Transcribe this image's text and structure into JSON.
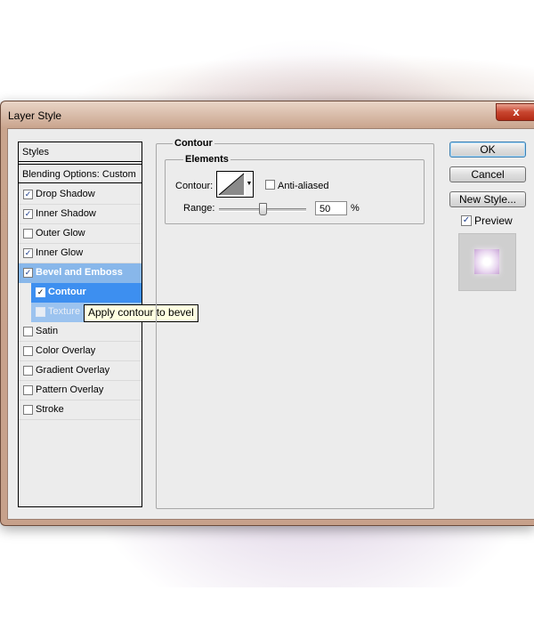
{
  "window": {
    "title": "Layer Style",
    "close_glyph": "x"
  },
  "styles": {
    "header": "Styles",
    "blending": "Blending Options: Custom",
    "items": [
      {
        "label": "Drop Shadow",
        "checked": true
      },
      {
        "label": "Inner Shadow",
        "checked": true
      },
      {
        "label": "Outer Glow",
        "checked": false
      },
      {
        "label": "Inner Glow",
        "checked": true
      },
      {
        "label": "Bevel and Emboss",
        "checked": true
      },
      {
        "label": "Contour",
        "checked": true
      },
      {
        "label": "Texture",
        "checked": false
      },
      {
        "label": "Satin",
        "checked": false
      },
      {
        "label": "Color Overlay",
        "checked": false
      },
      {
        "label": "Gradient Overlay",
        "checked": false
      },
      {
        "label": "Pattern Overlay",
        "checked": false
      },
      {
        "label": "Stroke",
        "checked": false
      }
    ]
  },
  "tooltip": "Apply contour to bevel",
  "contour": {
    "group_title": "Contour",
    "elements_title": "Elements",
    "contour_label": "Contour:",
    "anti_aliased_label": "Anti-aliased",
    "anti_aliased": false,
    "range_label": "Range:",
    "range_value": "50",
    "range_unit": "%",
    "range_fraction": 0.5
  },
  "buttons": {
    "ok": "OK",
    "cancel": "Cancel",
    "new_style": "New Style..."
  },
  "preview": {
    "label": "Preview",
    "checked": true
  },
  "colors": {
    "selected_item": "#3d8ff0",
    "selected_parent": "#88b7ea",
    "tooltip_bg": "#ffffe1"
  }
}
